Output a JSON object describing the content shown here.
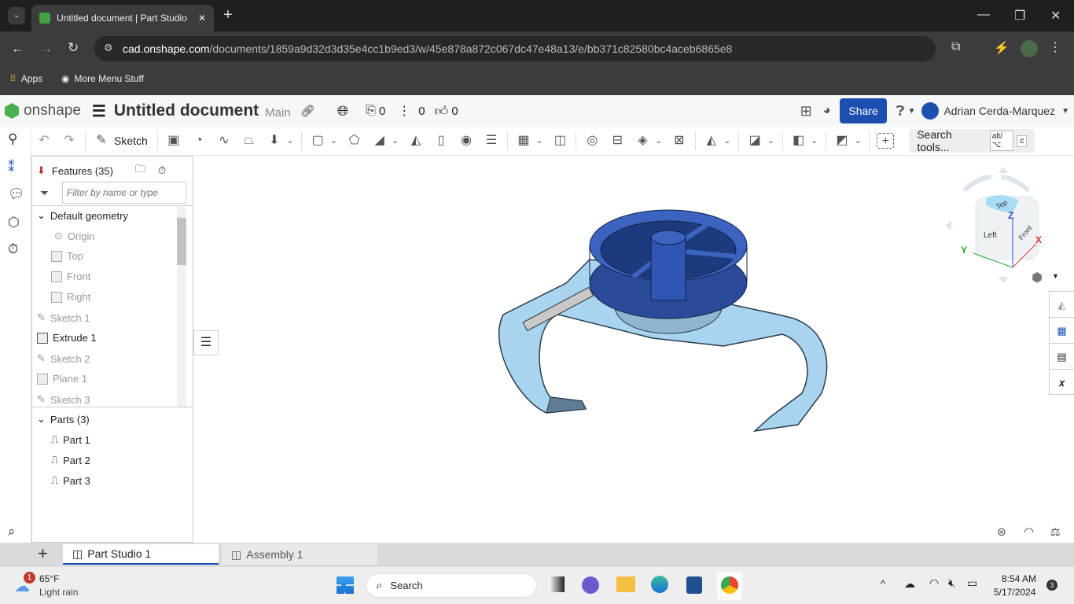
{
  "browser": {
    "tab_title": "Untitled document | Part Studio",
    "url_host": "cad.onshape.com",
    "url_path": "/documents/1859a9d32d3d35e4cc1b9ed3/w/45e878a872c067dc47e48a13/e/bb371c82580bc4aceb6865e8",
    "bookmarks": [
      {
        "label": "Apps",
        "icon": "apps-grid-icon"
      },
      {
        "label": "More Menu Stuff",
        "icon": "globe-icon"
      }
    ]
  },
  "header": {
    "brand": "onshape",
    "doc_title": "Untitled document",
    "branch": "Main",
    "versions_count": "0",
    "branches_count": "0",
    "likes_count": "0",
    "share_label": "Share",
    "user_name": "Adrian Cerda-Marquez",
    "accent": "#1d4fb0"
  },
  "toolbar": {
    "sketch_label": "Sketch",
    "search_label": "Search tools...",
    "shortcut_1": "alt/⌥",
    "shortcut_2": "c"
  },
  "features": {
    "title": "Features (35)",
    "filter_placeholder": "Filter by name or type",
    "default_group": "Default geometry",
    "items": [
      {
        "label": "Origin",
        "dim": true
      },
      {
        "label": "Top",
        "dim": true
      },
      {
        "label": "Front",
        "dim": true
      },
      {
        "label": "Right",
        "dim": true
      },
      {
        "label": "Sketch 1",
        "dim": true
      },
      {
        "label": "Extrude 1",
        "dim": false
      },
      {
        "label": "Sketch 2",
        "dim": true
      },
      {
        "label": "Plane 1",
        "dim": true
      },
      {
        "label": "Sketch 3",
        "dim": true
      }
    ],
    "parts_title": "Parts (3)",
    "parts": [
      "Part 1",
      "Part 2",
      "Part 3"
    ]
  },
  "viewcube": {
    "top": "Top",
    "left": "Left",
    "front": "Front",
    "x": "X",
    "y": "Y",
    "z": "Z"
  },
  "tabs": [
    {
      "label": "Part Studio 1",
      "active": true
    },
    {
      "label": "Assembly 1",
      "active": false
    }
  ],
  "taskbar": {
    "temp": "65°F",
    "weather": "Light rain",
    "weather_badge": "1",
    "search": "Search",
    "time": "8:54 AM",
    "date": "5/17/2024",
    "notif": "3"
  }
}
